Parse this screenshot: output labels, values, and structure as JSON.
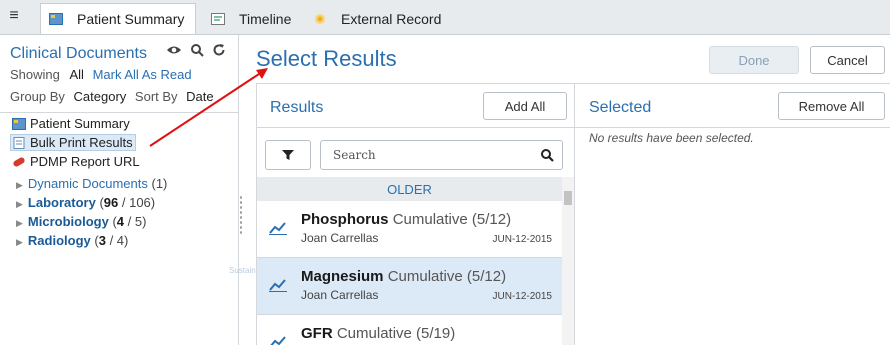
{
  "tabs": [
    {
      "label": "Patient Summary",
      "icon": "patient-summary-icon",
      "active": true
    },
    {
      "label": "Timeline",
      "icon": "timeline-icon",
      "active": false
    },
    {
      "label": "External Record",
      "icon": "external-record-icon",
      "active": false
    }
  ],
  "left": {
    "title": "Clinical Documents",
    "showing_label": "Showing",
    "showing_value": "All",
    "mark_all": "Mark All As Read",
    "group_by_label": "Group By",
    "group_by_value": "Category",
    "sort_by_label": "Sort By",
    "sort_by_value": "Date",
    "items": [
      {
        "label": "Patient Summary"
      },
      {
        "label": "Bulk Print Results"
      },
      {
        "label": "PDMP Report URL"
      }
    ],
    "folders": [
      {
        "label": "Dynamic Documents",
        "count": "(1)"
      },
      {
        "label": "Laboratory",
        "count_open": "(",
        "count_bold": "96",
        "count_rest": " / 106)"
      },
      {
        "label": "Microbiology",
        "count_open": "(",
        "count_bold": "4",
        "count_rest": " / 5)"
      },
      {
        "label": "Radiology",
        "count_open": "(",
        "count_bold": "3",
        "count_rest": " / 4)"
      }
    ],
    "ghost_text": "Sustain-for-Sys"
  },
  "main": {
    "title": "Select Results",
    "done_label": "Done",
    "cancel_label": "Cancel",
    "results_title": "Results",
    "add_all_label": "Add All",
    "selected_title": "Selected",
    "remove_all_label": "Remove All",
    "search_placeholder": "Search",
    "older_label": "OLDER",
    "no_selection": "No results have been selected.",
    "results": [
      {
        "name": "Phosphorus",
        "kind": "Cumulative (5/12)",
        "who": "Joan Carrellas",
        "date": "JUN-12-2015",
        "selected": false
      },
      {
        "name": "Magnesium",
        "kind": "Cumulative (5/12)",
        "who": "Joan Carrellas",
        "date": "JUN-12-2015",
        "selected": true
      },
      {
        "name": "GFR",
        "kind": "Cumulative (5/19)",
        "who": "",
        "date": "",
        "selected": false
      }
    ]
  },
  "colors": {
    "accent": "#2a6fb0",
    "selected_bg": "#dce9f7",
    "arrow": "#e01010"
  }
}
